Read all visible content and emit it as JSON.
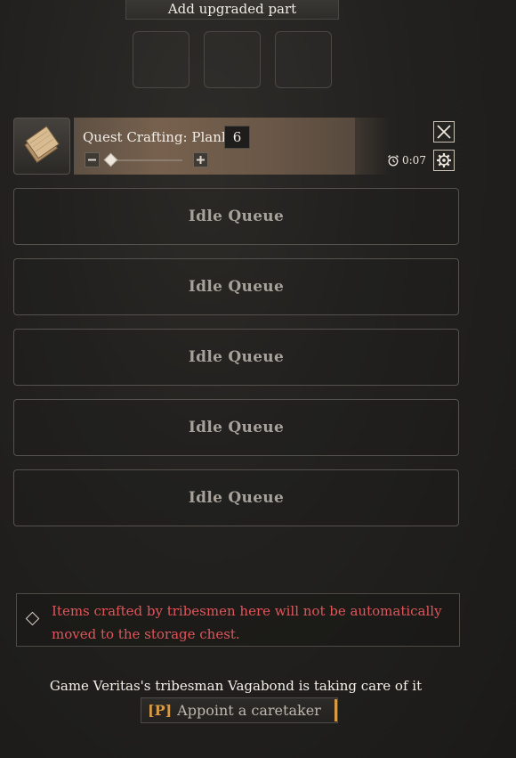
{
  "header": {
    "title": "Add upgraded part"
  },
  "upgrade_slots": [
    {},
    {},
    {}
  ],
  "active_craft": {
    "item_icon": "plank-icon",
    "title": "Quest Crafting: Plank",
    "quantity": "6",
    "timer": "0:07",
    "slider_fraction": 0.0
  },
  "queues": [
    {
      "label": "Idle Queue"
    },
    {
      "label": "Idle Queue"
    },
    {
      "label": "Idle Queue"
    },
    {
      "label": "Idle Queue"
    },
    {
      "label": "Idle Queue"
    }
  ],
  "warning": {
    "line1": "Items crafted by tribesmen here will not be automatically",
    "line2": "moved to the storage chest."
  },
  "caretaker": {
    "status": "Game Veritas's tribesman Vagabond is taking care of it",
    "key": "[P]",
    "button_label": "Appoint a caretaker"
  },
  "colors": {
    "warning": "#e0555a",
    "key_accent": "#d79a46"
  }
}
